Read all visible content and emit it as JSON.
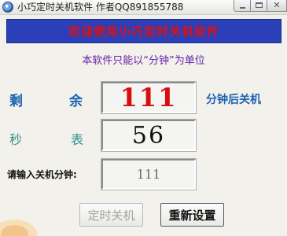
{
  "window": {
    "title": "小巧定时关机软件  作者QQ891855788"
  },
  "banner": {
    "text": "欢迎使用小巧定时关机软件"
  },
  "subtitle": "本软件只能以“分钟”为单位",
  "remaining": {
    "label_left": "剩",
    "label_right": "余",
    "value": "111",
    "suffix": "分钟后关机"
  },
  "stopwatch": {
    "label_left": "秒",
    "label_right": "表",
    "value": "56"
  },
  "shutdown_minutes": {
    "label": "请输入关机分钟:",
    "value": "111"
  },
  "buttons": {
    "timer_shutdown": "定时关机",
    "reset": "重新设置"
  },
  "colors": {
    "banner_background": "#2a3fb8",
    "banner_text": "#e01010",
    "countdown_digits": "#d80d0d",
    "label_blue": "#1c63b0",
    "label_teal": "#2f8f8a",
    "subtitle_purple": "#6a1fa8"
  },
  "icons": {
    "app": "app-icon",
    "minimize": "minimize-icon",
    "maximize": "maximize-icon",
    "close": "close-icon"
  }
}
